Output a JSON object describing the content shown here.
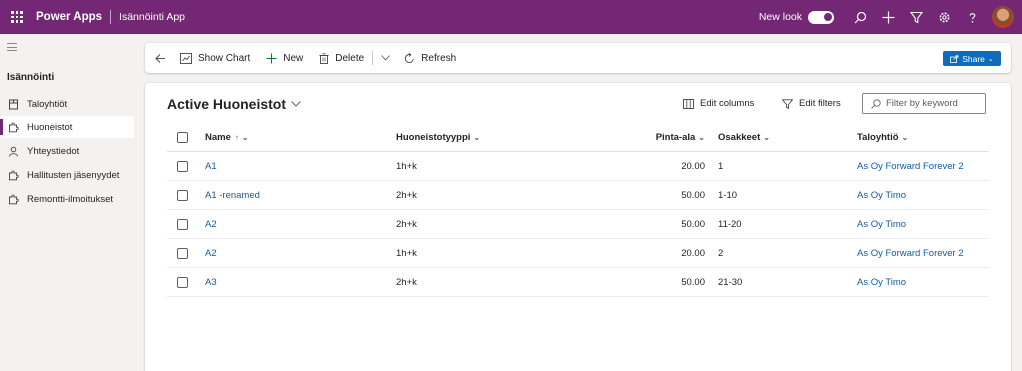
{
  "topbar": {
    "app_name": "Power Apps",
    "sub_app": "Isännöinti App",
    "new_look_label": "New look",
    "new_look_on": true
  },
  "sidebar": {
    "group_label": "Isännöinti",
    "items": [
      {
        "label": "Taloyhtiöt",
        "icon": "building-icon"
      },
      {
        "label": "Huoneistot",
        "icon": "puzzle-icon",
        "active": true
      },
      {
        "label": "Yhteystiedot",
        "icon": "person-icon"
      },
      {
        "label": "Hallitusten jäsenyydet",
        "icon": "puzzle-icon"
      },
      {
        "label": "Remontti-ilmoitukset",
        "icon": "puzzle-icon"
      }
    ]
  },
  "commandbar": {
    "show_chart": "Show Chart",
    "new": "New",
    "delete": "Delete",
    "refresh": "Refresh",
    "share": "Share"
  },
  "view": {
    "title": "Active Huoneistot",
    "edit_columns": "Edit columns",
    "edit_filters": "Edit filters",
    "search_placeholder": "Filter by keyword"
  },
  "grid": {
    "columns": [
      "Name",
      "Huoneistotyyppi",
      "Pinta-ala",
      "Osakkeet",
      "Taloyhtiö"
    ],
    "sort_arrow": "↑",
    "rows": [
      {
        "name": "A1",
        "type": "1h+k",
        "area": "20.00",
        "shares": "1",
        "house": "As Oy Forward Forever 2"
      },
      {
        "name": "A1 -renamed",
        "type": "2h+k",
        "area": "50.00",
        "shares": "1-10",
        "house": "As Oy Timo"
      },
      {
        "name": "A2",
        "type": "2h+k",
        "area": "50.00",
        "shares": "11-20",
        "house": "As Oy Timo"
      },
      {
        "name": "A2",
        "type": "1h+k",
        "area": "20.00",
        "shares": "2",
        "house": "As Oy Forward Forever 2"
      },
      {
        "name": "A3",
        "type": "2h+k",
        "area": "50.00",
        "shares": "21-30",
        "house": "As Oy Timo"
      }
    ]
  },
  "colors": {
    "brand": "#742774",
    "link": "#115ea3",
    "accent": "#0f6cbd"
  }
}
